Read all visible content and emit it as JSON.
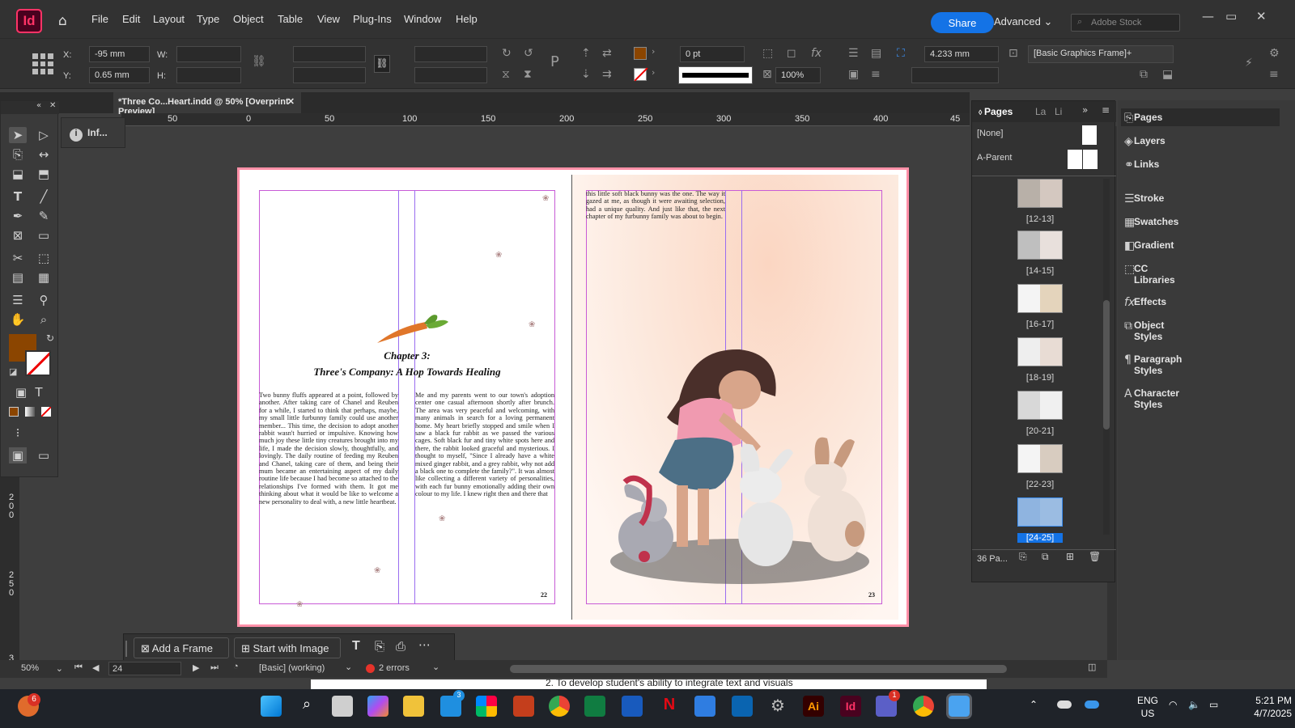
{
  "app": {
    "logo": "Id",
    "share_label": "Share",
    "workspace": "Advanced",
    "stock_placeholder": "Adobe Stock"
  },
  "menu": [
    "File",
    "Edit",
    "Layout",
    "Type",
    "Object",
    "Table",
    "View",
    "Plug-Ins",
    "Window",
    "Help"
  ],
  "control": {
    "x_label": "X:",
    "x_value": "-95 mm",
    "y_label": "Y:",
    "y_value": "0.65 mm",
    "w_label": "W:",
    "h_label": "H:",
    "stroke_weight": "0 pt",
    "opacity": "100%",
    "offset": "4.233 mm",
    "object_style": "[Basic Graphics Frame]+",
    "fill_color": "#8b4500"
  },
  "document": {
    "tab_title": "*Three Co...Heart.indd @ 50% [Overprint Preview]",
    "ruler_ticks": [
      "50",
      "0",
      "50",
      "100",
      "150",
      "200",
      "250",
      "300",
      "350",
      "400",
      "45"
    ],
    "vruler_ticks": [
      "200",
      "250",
      "3"
    ],
    "chapter_label": "Chapter 3:",
    "chapter_title": "Three's Company: A Hop Towards Healing",
    "left_col_text": "Two bunny fluffs appeared at a point, followed by another. After taking care of Chanel and Reuben for a while, I started to think that perhaps, maybe, my small little furbunny family could use another member... This time, the decision to adopt another rabbit wasn't hurried or impulsive. Knowing how much joy these little tiny creatures brought into my life, I made the decision slowly, thoughtfully, and lovingly. The daily routine of feeding my Reuben and Chanel, taking care of them, and being their mum became an entertaining aspect of my daily routine life because I had become so attached to the relationships I've formed with them. It got me thinking about what it would be like to welcome a new personality to deal with, a new little heartbeat.",
    "right_col_text": "Me and my parents went to our town's adoption center one casual afternoon shortly after brunch. The area was very peaceful and welcoming, with many animals in search for a loving permanent home. My heart briefly stopped and smile when I saw a black fur rabbit as we passed the various cages. Soft black fur and tiny white spots here and there, the rabbit looked graceful and mysterious. I thought to myself, \"Since I already have a white mixed ginger rabbit, and a grey rabbit, why not add a black one to complete the family?\". It was almost like collecting a different variety of personalities, with each fur bunny emotionally adding their own colour to my life. I knew right then and there that",
    "page23_text": "this little soft black bunny was the one. The way it gazed at me, as though it were awaiting selection, had a unique quality. And just like that, the next chapter of my furbunny family was about to begin.",
    "page_left_num": "22",
    "page_right_num": "23"
  },
  "tools_panel": {
    "info_label": "Inf..."
  },
  "ctx_bar": {
    "add_frame": "Add a Frame",
    "start_image": "Start with Image"
  },
  "status": {
    "zoom": "50%",
    "page": "24",
    "preflight_profile": "[Basic] (working)",
    "errors": "2 errors"
  },
  "doc_strip_text": "2.     To develop student's ability to integrate text and visuals",
  "pages_panel": {
    "tabs": [
      "Pages",
      "La",
      "Li"
    ],
    "masters": [
      "[None]",
      "A-Parent"
    ],
    "spreads": [
      "[12-13]",
      "[14-15]",
      "[16-17]",
      "[18-19]",
      "[20-21]",
      "[22-23]",
      "[24-25]"
    ],
    "count": "36 Pa..."
  },
  "side_panel": [
    "Pages",
    "Layers",
    "Links",
    "Stroke",
    "Swatches",
    "Gradient",
    "CC Libraries",
    "Effects",
    "Object Styles",
    "Paragraph Styles",
    "Character Styles"
  ],
  "taskbar": {
    "lang1": "ENG",
    "lang2": "US",
    "time": "5:21 PM",
    "date": "4/7/2025",
    "badge_left": "6",
    "badge_mail": "3",
    "badge_teams": "1"
  }
}
